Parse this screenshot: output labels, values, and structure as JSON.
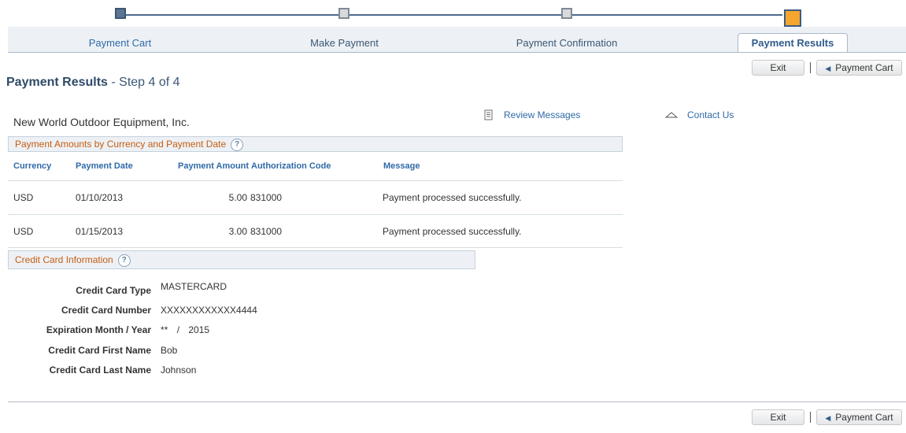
{
  "train": {
    "steps": [
      {
        "label": "Payment Cart",
        "state": "done"
      },
      {
        "label": "Make Payment",
        "state": "todo"
      },
      {
        "label": "Payment Confirmation",
        "state": "todo"
      },
      {
        "label": "Payment Results",
        "state": "current"
      }
    ]
  },
  "toolbar": {
    "exit_label": "Exit",
    "payment_cart_label": "Payment Cart"
  },
  "page": {
    "title_bold": "Payment Results",
    "title_rest": " - Step 4 of 4",
    "company": "New World Outdoor Equipment, Inc.",
    "review_messages": "Review Messages",
    "contact_us": "Contact Us"
  },
  "payments": {
    "header": "Payment Amounts by Currency and Payment Date",
    "columns": [
      "Currency",
      "Payment Date",
      "Payment Amount",
      "Authorization Code",
      "Message"
    ],
    "rows": [
      {
        "currency": "USD",
        "date": "01/10/2013",
        "amount": "5.00",
        "auth": "831000",
        "message": "Payment processed successfully."
      },
      {
        "currency": "USD",
        "date": "01/15/2013",
        "amount": "3.00",
        "auth": "831000",
        "message": "Payment processed successfully."
      }
    ]
  },
  "card": {
    "header": "Credit Card Information",
    "type_label": "Credit Card Type",
    "type_value": "MASTERCARD",
    "number_label": "Credit Card Number",
    "number_value": "XXXXXXXXXXXX4444",
    "exp_label": "Expiration Month / Year",
    "exp_month": "**",
    "exp_sep": "/",
    "exp_year": "2015",
    "first_label": "Credit Card First Name",
    "first_value": "Bob",
    "last_label": "Credit Card Last Name",
    "last_value": "Johnson"
  },
  "colors": {
    "accent": "#2f6aa8",
    "group_header_text": "#c65d12",
    "current_step": "#f6a62e"
  }
}
